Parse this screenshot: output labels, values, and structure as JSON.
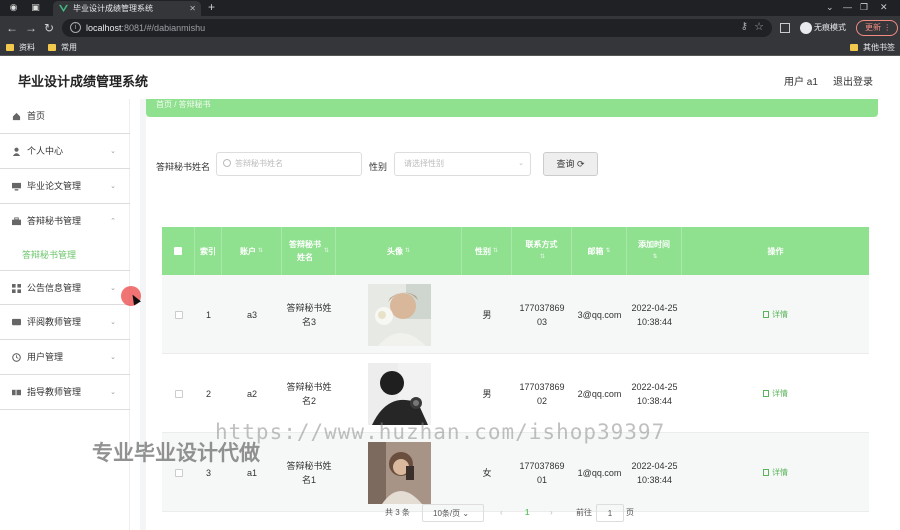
{
  "browser": {
    "tab_title": "毕业设计成绩管理系统",
    "url_host": "localhost",
    "url_path": ":8081/#/dabianmishu",
    "incognito_label": "无痕模式",
    "update_label": "更新",
    "bookmarks": [
      "资料",
      "常用",
      "其他书签"
    ]
  },
  "header": {
    "title": "毕业设计成绩管理系统",
    "user_label": "用户 a1",
    "logout_label": "退出登录"
  },
  "sidebar": {
    "items": [
      {
        "label": "首页",
        "icon": "home-icon"
      },
      {
        "label": "个人中心",
        "icon": "user-icon"
      },
      {
        "label": "毕业论文管理",
        "icon": "monitor-icon"
      },
      {
        "label": "答辩秘书管理",
        "icon": "briefcase-icon"
      },
      {
        "label": "公告信息管理",
        "icon": "grid-icon"
      },
      {
        "label": "评阅教师管理",
        "icon": "chat-icon"
      },
      {
        "label": "用户管理",
        "icon": "clock-icon"
      },
      {
        "label": "指导教师管理",
        "icon": "tickets-icon"
      }
    ],
    "sub_item": "答辩秘书管理"
  },
  "breadcrumb": {
    "home": "首页",
    "current": "答辩秘书"
  },
  "search": {
    "name_label": "答辩秘书姓名",
    "name_placeholder": "答辩秘书姓名",
    "gender_label": "性别",
    "gender_placeholder": "请选择性别",
    "query_label": "查询"
  },
  "table": {
    "headers": [
      "索引",
      "账户",
      "答辩秘书姓名",
      "头像",
      "性别",
      "联系方式",
      "邮箱",
      "添加时间",
      "操作"
    ],
    "rows": [
      {
        "index": "1",
        "account": "a3",
        "name": "答辩秘书姓名3",
        "gender": "男",
        "phone": "17703786903",
        "email": "3@qq.com",
        "added": "2022-04-25 10:38:44",
        "action": "详情"
      },
      {
        "index": "2",
        "account": "a2",
        "name": "答辩秘书姓名2",
        "gender": "男",
        "phone": "17703786902",
        "email": "2@qq.com",
        "added": "2022-04-25 10:38:44",
        "action": "详情"
      },
      {
        "index": "3",
        "account": "a1",
        "name": "答辩秘书姓名1",
        "gender": "女",
        "phone": "17703786901",
        "email": "1@qq.com",
        "added": "2022-04-25 10:38:44",
        "action": "详情"
      }
    ]
  },
  "pagination": {
    "total": "共 3 条",
    "page_size": "10条/页",
    "current_page": "1",
    "goto_label": "前往",
    "goto_value": "1",
    "page_unit": "页"
  },
  "watermark": {
    "url": "https://www.huzhan.com/ishop39397",
    "text": "专业毕业设计代做"
  },
  "colors": {
    "accent": "#8fe08f",
    "link": "#6cc56c",
    "cursor": "#eb4646"
  }
}
